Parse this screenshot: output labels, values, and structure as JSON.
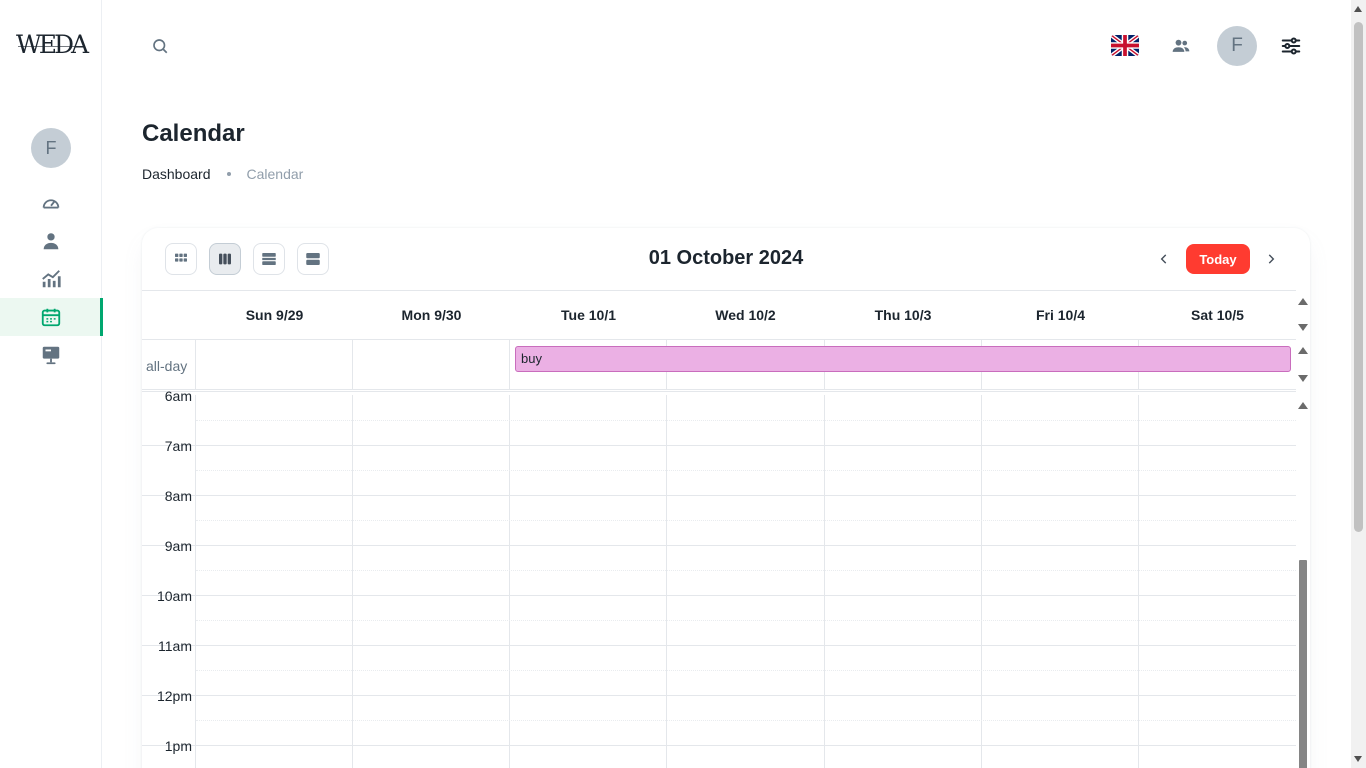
{
  "brand": {
    "logo_text": "WEDA"
  },
  "sidebar": {
    "avatar_initial": "F",
    "items": [
      {
        "name": "dashboard",
        "icon": "gauge-icon",
        "active": false
      },
      {
        "name": "user",
        "icon": "user-icon",
        "active": false
      },
      {
        "name": "analytics",
        "icon": "chart-icon",
        "active": false
      },
      {
        "name": "calendar",
        "icon": "calendar-icon",
        "active": true
      },
      {
        "name": "presentation",
        "icon": "presentation-icon",
        "active": false
      }
    ]
  },
  "header": {
    "language_flag": "uk-flag-icon",
    "avatar_initial": "F"
  },
  "page": {
    "title": "Calendar",
    "breadcrumbs": [
      "Dashboard",
      "Calendar"
    ]
  },
  "calendar": {
    "current_date": "01 October 2024",
    "today_label": "Today",
    "views": [
      "month",
      "week",
      "day",
      "agenda"
    ],
    "selected_view": "week",
    "days": [
      "Sun 9/29",
      "Mon 9/30",
      "Tue 10/1",
      "Wed 10/2",
      "Thu 10/3",
      "Fri 10/4",
      "Sat 10/5"
    ],
    "allday_label": "all-day",
    "events": [
      {
        "title": "buy",
        "start_day": "Tue 10/1",
        "end_day": "Sat 10/5",
        "color": "#ebb0e4"
      }
    ],
    "hours": [
      "6am",
      "7am",
      "8am",
      "9am",
      "10am",
      "11am",
      "12pm",
      "1pm"
    ]
  },
  "colors": {
    "accent": "#00a76f",
    "today_button": "#ff3b30",
    "event": "#ebb0e4"
  }
}
